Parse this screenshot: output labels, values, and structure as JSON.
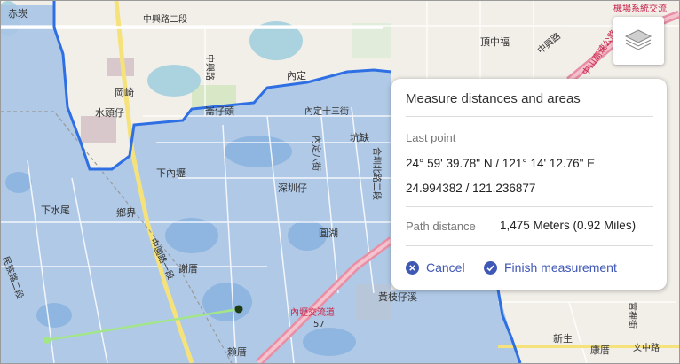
{
  "map": {
    "places": [
      "赤崁",
      "中興路二段",
      "中興路",
      "內定",
      "岡崎",
      "水頭仔",
      "崙仔頭",
      "內定十三街",
      "坑缺",
      "內定八街",
      "合圳北路二段",
      "下內壢",
      "深圳仔",
      "下水尾",
      "鄉界",
      "中園路一段",
      "圓湖",
      "謝厝",
      "內壢交流道",
      "57",
      "黃枝仔溪",
      "賴厝",
      "頂中福",
      "中興路",
      "中山高速公路",
      "機場系統交流",
      "霄裡街",
      "新生",
      "文中路",
      "康厝",
      "民族路二段"
    ],
    "colors": {
      "area_fill": "#a9c4e6",
      "boundary": "#2f6fe4",
      "measure_line": "#a3e68a",
      "expressway": "#e88fa5",
      "red_text": "#c8244a"
    }
  },
  "layers_button": {
    "icon": "layers-icon"
  },
  "measure_panel": {
    "title": "Measure distances and areas",
    "last_point_label": "Last point",
    "last_point_dms": "24° 59' 39.78\" N / 121° 14' 12.76\" E",
    "last_point_decimal": "24.994382 / 121.236877",
    "path_distance_label": "Path distance",
    "path_distance_value": "1,475 Meters (0.92 Miles)",
    "cancel_label": "Cancel",
    "finish_label": "Finish measurement",
    "accent_color": "#3f57b5"
  }
}
